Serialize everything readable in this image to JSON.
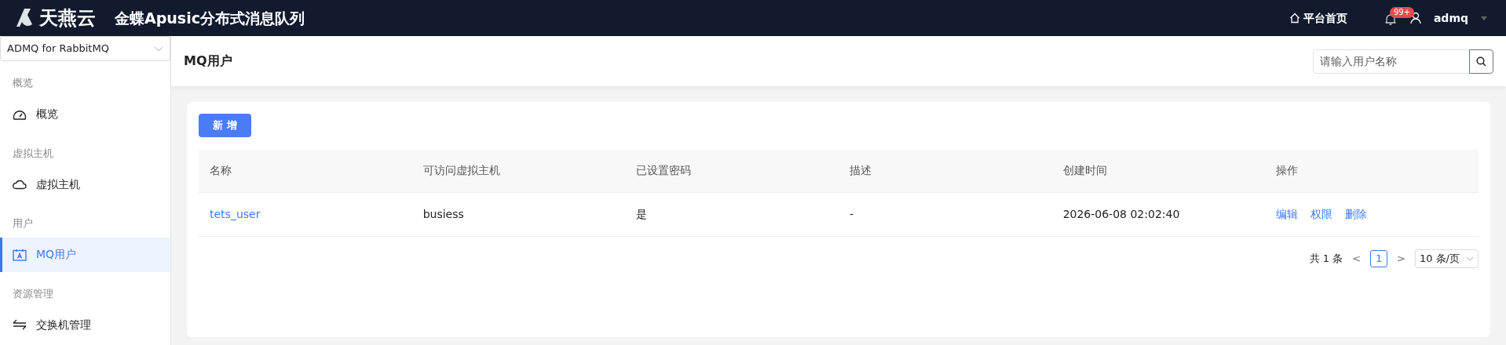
{
  "header": {
    "brand": "天燕云",
    "product": "金蝶Apusic分布式消息队列",
    "home_link": "平台首页",
    "notification_badge": "99+",
    "user": "admq"
  },
  "sidebar": {
    "selector": "ADMQ for RabbitMQ",
    "groups": [
      {
        "label": "概览",
        "items": [
          {
            "label": "概览",
            "selected": false
          }
        ]
      },
      {
        "label": "虚拟主机",
        "items": [
          {
            "label": "虚拟主机",
            "selected": false
          }
        ]
      },
      {
        "label": "用户",
        "items": [
          {
            "label": "MQ用户",
            "selected": true
          }
        ]
      },
      {
        "label": "资源管理",
        "items": [
          {
            "label": "交换机管理",
            "selected": false
          }
        ]
      }
    ]
  },
  "page": {
    "title": "MQ用户",
    "search": {
      "placeholder": "请输入用户名称"
    },
    "add_button": "新 增"
  },
  "table": {
    "columns": [
      "名称",
      "可访问虚拟主机",
      "已设置密码",
      "描述",
      "创建时间",
      "操作"
    ],
    "rows": [
      {
        "name": "tets_user",
        "vhost": "busiess",
        "password_set": "是",
        "description": "-",
        "created": "2026-06-08 02:02:40",
        "actions": [
          "编辑",
          "权限",
          "删除"
        ]
      }
    ]
  },
  "pagination": {
    "total": "共 1 条",
    "prev": "<",
    "pages": [
      {
        "label": "1",
        "selected": true
      }
    ],
    "next": ">",
    "page_size": "10 条/页"
  }
}
